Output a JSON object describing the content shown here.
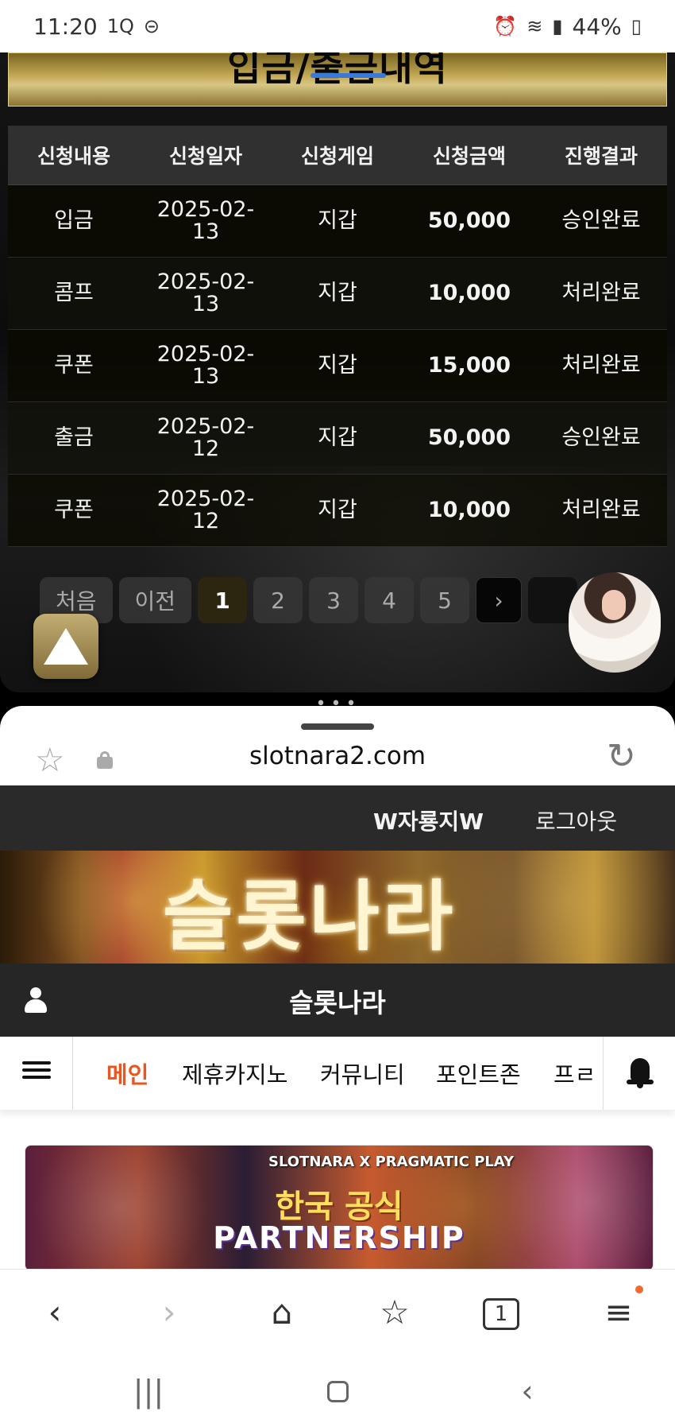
{
  "status": {
    "time": "11:20",
    "left_icons": [
      "1Q",
      "⊝"
    ],
    "battery": "44%",
    "right_icons": [
      "alarm-icon",
      "wifi-icon",
      "signal-icon",
      "battery-icon"
    ]
  },
  "popup": {
    "title": "입금/출금내역",
    "table": {
      "headers": [
        "신청내용",
        "신청일자",
        "신청게임",
        "신청금액",
        "진행결과"
      ],
      "rows": [
        {
          "type": "입금",
          "date": "2025-02-\n13",
          "game": "지갑",
          "amount": "50,000",
          "result": "승인완료"
        },
        {
          "type": "콤프",
          "date": "2025-02-\n13",
          "game": "지갑",
          "amount": "10,000",
          "result": "처리완료"
        },
        {
          "type": "쿠폰",
          "date": "2025-02-\n13",
          "game": "지갑",
          "amount": "15,000",
          "result": "처리완료"
        },
        {
          "type": "출금",
          "date": "2025-02-\n12",
          "game": "지갑",
          "amount": "50,000",
          "result": "승인완료"
        },
        {
          "type": "쿠폰",
          "date": "2025-02-\n12",
          "game": "지갑",
          "amount": "10,000",
          "result": "처리완료"
        }
      ]
    },
    "pagination": {
      "first": "처음",
      "prev": "이전",
      "pages": [
        "1",
        "2",
        "3",
        "4",
        "5"
      ],
      "active_page": "1",
      "next_icon": "›"
    }
  },
  "browser": {
    "url": "slotnara2.com"
  },
  "site": {
    "username": "W자룡지W",
    "logout": "로그아웃",
    "banner_title": "슬롯나라",
    "title": "슬롯나라",
    "nav": [
      {
        "label": "메인",
        "active": true
      },
      {
        "label": "제휴카지노",
        "active": false
      },
      {
        "label": "커뮤니티",
        "active": false
      },
      {
        "label": "포인트존",
        "active": false
      },
      {
        "label": "프ㄹ",
        "active": false
      }
    ],
    "partner": {
      "brand": "SLOTNARA X PRAGMATIC PLAY",
      "line1": "한국 공식",
      "line2": "PARTNERSHIP"
    }
  },
  "bottom_nav": {
    "tabs_count": "1",
    "icons": [
      "back-icon",
      "forward-icon",
      "home-icon",
      "bookmarks-icon",
      "tabs-icon",
      "menu-icon"
    ]
  },
  "system_nav": {
    "icons": [
      "recent-apps-icon",
      "home-button-icon",
      "system-back-icon"
    ]
  }
}
